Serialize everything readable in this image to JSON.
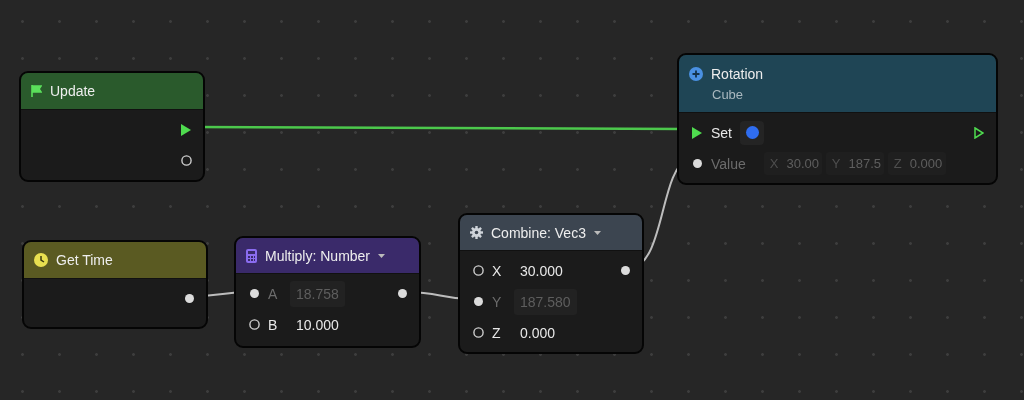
{
  "nodes": [
    {
      "kind": "event",
      "title": "Update",
      "color": "#2a5a2c",
      "rows": [
        {
          "output_port": {
            "kind": "exec"
          }
        },
        {
          "output_port": {
            "kind": "open"
          }
        }
      ]
    },
    {
      "kind": "getter",
      "title": "Get Time",
      "color": "#5a5a22",
      "rows": [
        {
          "output_port": {
            "kind": "linked"
          }
        }
      ]
    },
    {
      "kind": "math",
      "title": "Multiply: Number",
      "color": "#3a2a6a",
      "dropdown": true,
      "rows": [
        {
          "input_port": {
            "kind": "linked"
          },
          "label": "A",
          "value": "18.758",
          "output_port": {
            "kind": "linked"
          }
        },
        {
          "input_port": {
            "kind": "open"
          },
          "label": "B",
          "value": "10.000"
        }
      ]
    },
    {
      "kind": "combine",
      "title": "Combine: Vec3",
      "color": "#3c4550",
      "dropdown": true,
      "rows": [
        {
          "input_port": {
            "kind": "open"
          },
          "label": "X",
          "value": "30.000",
          "output_port": {
            "kind": "linked"
          }
        },
        {
          "input_port": {
            "kind": "linked"
          },
          "label": "Y",
          "value": "187.580"
        },
        {
          "input_port": {
            "kind": "open"
          },
          "label": "Z",
          "value": "0.000"
        }
      ]
    },
    {
      "kind": "setter",
      "title": "Rotation",
      "subtitle": "Cube",
      "color": "#1f4555",
      "rows": [
        {
          "input_port": {
            "kind": "exec"
          },
          "label": "Set",
          "toggle": {
            "on": true
          },
          "output_port": {
            "kind": "exec-open"
          }
        },
        {
          "input_port": {
            "kind": "linked"
          },
          "label": "Value",
          "fields": [
            {
              "axis": "X",
              "value": "30.00"
            },
            {
              "axis": "Y",
              "value": "187.5"
            },
            {
              "axis": "Z",
              "value": "0.000"
            }
          ]
        }
      ]
    }
  ]
}
